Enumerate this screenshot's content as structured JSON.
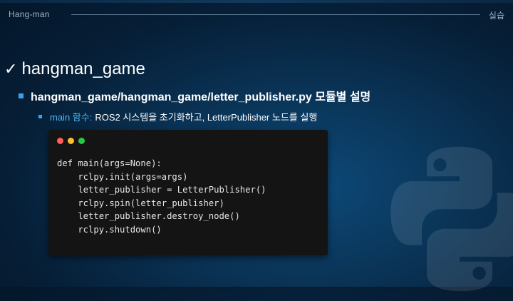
{
  "header": {
    "left_title": "Hang-man",
    "right_title": "실습"
  },
  "slide": {
    "heading_1": "hangman_game",
    "heading_2": "hangman_game/hangman_game/letter_publisher.py 모듈별 설명",
    "bullet_keyword": "main 함수:",
    "bullet_text": "ROS2 시스템을 초기화하고, LetterPublisher 노드를 실행"
  },
  "code_window": {
    "lines": [
      "def main(args=None):",
      "    rclpy.init(args=args)",
      "    letter_publisher = LetterPublisher()",
      "    rclpy.spin(letter_publisher)",
      "    letter_publisher.destroy_node()",
      "    rclpy.shutdown()"
    ]
  },
  "icons": {
    "check": "check-icon",
    "watermark": "python-logo-icon",
    "window_controls": [
      "close-dot-icon",
      "minimize-dot-icon",
      "maximize-dot-icon"
    ]
  },
  "colors": {
    "accent_blue": "#3aa0e8",
    "keyword_blue": "#4fb4f2",
    "code_bg": "#141414"
  }
}
